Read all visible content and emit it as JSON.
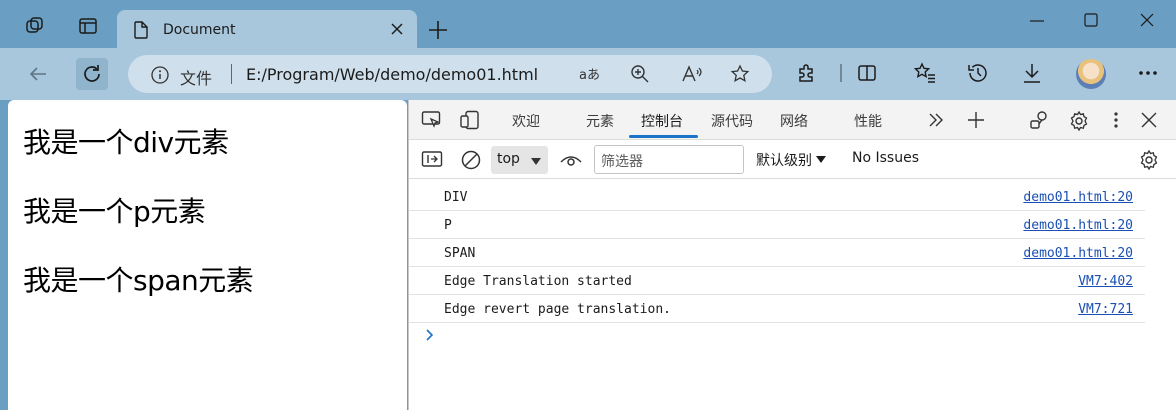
{
  "tab": {
    "title": "Document",
    "close_label": "×"
  },
  "window": {
    "minimize_label": "Minimize",
    "maximize_label": "Maximize",
    "close_label": "Close"
  },
  "address_bar": {
    "scheme_label": "文件",
    "url": "E:/Program/Web/demo/demo01.html"
  },
  "page": {
    "lines": [
      "我是一个div元素",
      "我是一个p元素",
      "我是一个span元素"
    ]
  },
  "devtools": {
    "tabs": [
      {
        "label": "欢迎"
      },
      {
        "label": "元素"
      },
      {
        "label": "控制台",
        "active": true
      },
      {
        "label": "源代码"
      },
      {
        "label": "网络"
      },
      {
        "label": "性能"
      }
    ],
    "toolbar": {
      "context": "top",
      "filter_placeholder": "筛选器",
      "levels_label": "默认级别",
      "issues_label": "No Issues"
    },
    "console": {
      "messages": [
        {
          "text": "DIV",
          "source": "demo01.html:20"
        },
        {
          "text": "P",
          "source": "demo01.html:20"
        },
        {
          "text": "SPAN",
          "source": "demo01.html:20"
        },
        {
          "text": "Edge Translation started",
          "source": "VM7:402"
        },
        {
          "text": "Edge revert page translation.",
          "source": "VM7:721"
        }
      ]
    }
  },
  "colors": {
    "titlebar": "#6a9fc3",
    "toolbar": "#a8c7dc",
    "accent": "#1a73c7",
    "link": "#1a4fb3"
  }
}
